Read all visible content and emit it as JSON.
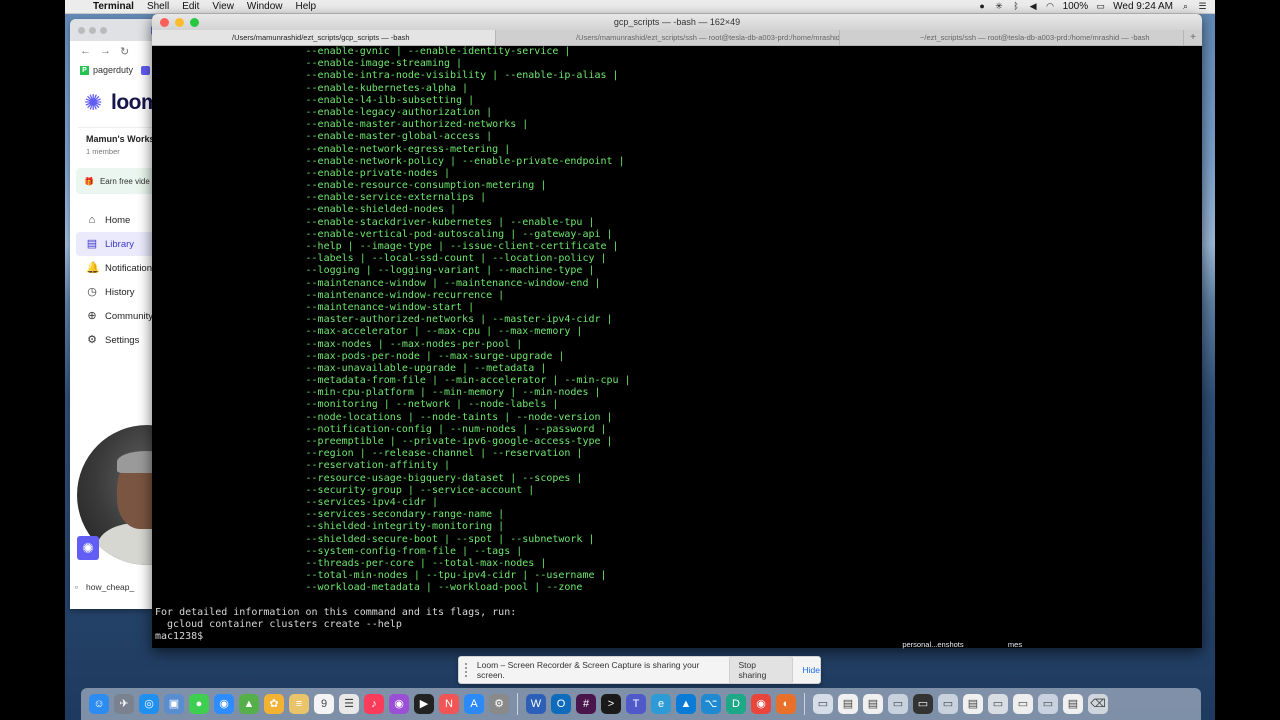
{
  "menubar": {
    "app_name": "Terminal",
    "items": [
      "Shell",
      "Edit",
      "View",
      "Window",
      "Help"
    ],
    "battery": "100%",
    "clock": "Wed 9:24 AM"
  },
  "browser": {
    "tab_fragment": "E",
    "bookmark": "pagerduty",
    "logo_text": "loom",
    "workspace_name": "Mamun's Works",
    "workspace_members": "1 member",
    "earn_text": "Earn free vide",
    "nav": [
      {
        "label": "Home",
        "icon": "home-icon"
      },
      {
        "label": "Library",
        "icon": "library-icon",
        "active": true
      },
      {
        "label": "Notification",
        "icon": "bell-icon"
      },
      {
        "label": "History",
        "icon": "clock-icon"
      },
      {
        "label": "Community",
        "icon": "globe-icon"
      },
      {
        "label": "Settings",
        "icon": "gear-icon"
      }
    ],
    "download_item": "how_cheap_"
  },
  "terminal": {
    "window_title": "gcp_scripts — -bash — 162×49",
    "tabs": [
      "/Users/mamunrashid/ezt_scripts/gcp_scripts — -bash",
      "/Users/mamunrashid/ezt_scripts/ssh — root@tesla-db-a003-prd:/home/mrashid",
      "~/ezt_scripts/ssh — root@tesla-db-a003-prd:/home/mrashid — -bash"
    ],
    "flag_lines": [
      "--enable-gvnic | --enable-identity-service |",
      "--enable-image-streaming |",
      "--enable-intra-node-visibility | --enable-ip-alias |",
      "--enable-kubernetes-alpha |",
      "--enable-l4-ilb-subsetting |",
      "--enable-legacy-authorization |",
      "--enable-master-authorized-networks |",
      "--enable-master-global-access |",
      "--enable-network-egress-metering |",
      "--enable-network-policy | --enable-private-endpoint |",
      "--enable-private-nodes |",
      "--enable-resource-consumption-metering |",
      "--enable-service-externalips |",
      "--enable-shielded-nodes |",
      "--enable-stackdriver-kubernetes | --enable-tpu |",
      "--enable-vertical-pod-autoscaling | --gateway-api |",
      "--help | --image-type | --issue-client-certificate |",
      "--labels | --local-ssd-count | --location-policy |",
      "--logging | --logging-variant | --machine-type |",
      "--maintenance-window | --maintenance-window-end |",
      "--maintenance-window-recurrence |",
      "--maintenance-window-start |",
      "--master-authorized-networks | --master-ipv4-cidr |",
      "--max-accelerator | --max-cpu | --max-memory |",
      "--max-nodes | --max-nodes-per-pool |",
      "--max-pods-per-node | --max-surge-upgrade |",
      "--max-unavailable-upgrade | --metadata |",
      "--metadata-from-file | --min-accelerator | --min-cpu |",
      "--min-cpu-platform | --min-memory | --min-nodes |",
      "--monitoring | --network | --node-labels |",
      "--node-locations | --node-taints | --node-version |",
      "--notification-config | --num-nodes | --password |",
      "--preemptible | --private-ipv6-google-access-type |",
      "--region | --release-channel | --reservation |",
      "--reservation-affinity |",
      "--resource-usage-bigquery-dataset | --scopes |",
      "--security-group | --service-account |",
      "--services-ipv4-cidr |",
      "--services-secondary-range-name |",
      "--shielded-integrity-monitoring |",
      "--shielded-secure-boot | --spot | --subnetwork |",
      "--system-config-from-file | --tags |",
      "--threads-per-core | --total-max-nodes |",
      "--total-min-nodes | --tpu-ipv4-cidr | --username |",
      "--workload-metadata | --workload-pool | --zone"
    ],
    "info_line": "For detailed information on this command and its flags, run:",
    "help_cmd": "  gcloud container clusters create --help",
    "prompt": "mac1238$"
  },
  "notice": {
    "text": "Loom – Screen Recorder & Screen Capture is sharing your screen.",
    "stop_label": "Stop sharing",
    "hide_label": "Hide"
  },
  "desktop_labels": [
    {
      "text": "personal...enshots"
    },
    {
      "text": "mes"
    }
  ],
  "dock": {
    "icons": [
      {
        "name": "finder-icon",
        "color": "#2d8cf0",
        "glyph": "☺"
      },
      {
        "name": "launchpad-icon",
        "color": "#7a8290",
        "glyph": "✈"
      },
      {
        "name": "safari-icon",
        "color": "#1f8ff0",
        "glyph": "◎"
      },
      {
        "name": "preview-icon",
        "color": "#5a8dcf",
        "glyph": "▣"
      },
      {
        "name": "messages-icon",
        "color": "#3fcf50",
        "glyph": "●"
      },
      {
        "name": "zoom-icon",
        "color": "#2d8cff",
        "glyph": "◉"
      },
      {
        "name": "maps-icon",
        "color": "#55b04a",
        "glyph": "▲"
      },
      {
        "name": "photos-icon",
        "color": "#f2b233",
        "glyph": "✿"
      },
      {
        "name": "notes-icon",
        "color": "#e9c46a",
        "glyph": "≡"
      },
      {
        "name": "calendar-icon",
        "color": "#f4f4f4",
        "glyph": "9"
      },
      {
        "name": "reminders-icon",
        "color": "#e8e8e8",
        "glyph": "☰"
      },
      {
        "name": "music-icon",
        "color": "#fa3c5a",
        "glyph": "♪"
      },
      {
        "name": "podcasts-icon",
        "color": "#9b4fd6",
        "glyph": "◉"
      },
      {
        "name": "tv-icon",
        "color": "#222222",
        "glyph": "▶"
      },
      {
        "name": "news-icon",
        "color": "#f25555",
        "glyph": "N"
      },
      {
        "name": "appstore-icon",
        "color": "#2b8af7",
        "glyph": "A"
      },
      {
        "name": "settings-icon",
        "color": "#8a8a8a",
        "glyph": "⚙"
      },
      {
        "name": "sep",
        "color": "",
        "glyph": ""
      },
      {
        "name": "word-icon",
        "color": "#2b5fb8",
        "glyph": "W"
      },
      {
        "name": "outlook-icon",
        "color": "#0f6cbd",
        "glyph": "O"
      },
      {
        "name": "slack-icon",
        "color": "#4a154b",
        "glyph": "#"
      },
      {
        "name": "terminal-icon",
        "color": "#1a1a1a",
        "glyph": ">"
      },
      {
        "name": "teams-icon",
        "color": "#5059c9",
        "glyph": "T"
      },
      {
        "name": "edge-icon",
        "color": "#2e9bd6",
        "glyph": "e"
      },
      {
        "name": "azure-icon",
        "color": "#0a7cd8",
        "glyph": "▲"
      },
      {
        "name": "vscode-icon",
        "color": "#1f8ad2",
        "glyph": "⌥"
      },
      {
        "name": "datagrip-icon",
        "color": "#1ea888",
        "glyph": "D"
      },
      {
        "name": "chrome-icon",
        "color": "#e9453a",
        "glyph": "◉"
      },
      {
        "name": "firefox-icon",
        "color": "#e8702a",
        "glyph": "◐"
      },
      {
        "name": "sep",
        "color": "",
        "glyph": ""
      },
      {
        "name": "folder-icon",
        "color": "#d4dde8",
        "glyph": "▭"
      },
      {
        "name": "document-icon",
        "color": "#f0f0f0",
        "glyph": "▤"
      },
      {
        "name": "document-icon",
        "color": "#f0f0f0",
        "glyph": "▤"
      },
      {
        "name": "screenshot-icon",
        "color": "#c8d2de",
        "glyph": "▭"
      },
      {
        "name": "screenshot-icon",
        "color": "#333333",
        "glyph": "▭"
      },
      {
        "name": "screenshot-icon",
        "color": "#c8d2de",
        "glyph": "▭"
      },
      {
        "name": "document-icon",
        "color": "#f0f0f0",
        "glyph": "▤"
      },
      {
        "name": "screenshot-icon",
        "color": "#d8dde3",
        "glyph": "▭"
      },
      {
        "name": "screenshot-icon",
        "color": "#eeeeee",
        "glyph": "▭"
      },
      {
        "name": "screenshot-icon",
        "color": "#c8d2de",
        "glyph": "▭"
      },
      {
        "name": "document-icon",
        "color": "#f0f0f0",
        "glyph": "▤"
      },
      {
        "name": "trash-icon",
        "color": "#cfd6dd",
        "glyph": "⌫"
      }
    ]
  },
  "colors": {
    "terminal_text": "#6ee66e",
    "loom_brand": "#625df5"
  }
}
